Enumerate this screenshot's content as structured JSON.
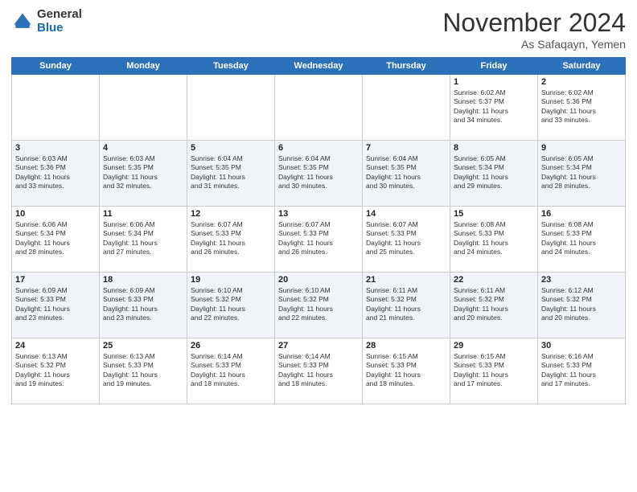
{
  "header": {
    "logo_general": "General",
    "logo_blue": "Blue",
    "month_title": "November 2024",
    "location": "As Safaqayn, Yemen"
  },
  "days_of_week": [
    "Sunday",
    "Monday",
    "Tuesday",
    "Wednesday",
    "Thursday",
    "Friday",
    "Saturday"
  ],
  "weeks": [
    [
      {
        "day": "",
        "info": ""
      },
      {
        "day": "",
        "info": ""
      },
      {
        "day": "",
        "info": ""
      },
      {
        "day": "",
        "info": ""
      },
      {
        "day": "",
        "info": ""
      },
      {
        "day": "1",
        "info": "Sunrise: 6:02 AM\nSunset: 5:37 PM\nDaylight: 11 hours\nand 34 minutes."
      },
      {
        "day": "2",
        "info": "Sunrise: 6:02 AM\nSunset: 5:36 PM\nDaylight: 11 hours\nand 33 minutes."
      }
    ],
    [
      {
        "day": "3",
        "info": "Sunrise: 6:03 AM\nSunset: 5:36 PM\nDaylight: 11 hours\nand 33 minutes."
      },
      {
        "day": "4",
        "info": "Sunrise: 6:03 AM\nSunset: 5:35 PM\nDaylight: 11 hours\nand 32 minutes."
      },
      {
        "day": "5",
        "info": "Sunrise: 6:04 AM\nSunset: 5:35 PM\nDaylight: 11 hours\nand 31 minutes."
      },
      {
        "day": "6",
        "info": "Sunrise: 6:04 AM\nSunset: 5:35 PM\nDaylight: 11 hours\nand 30 minutes."
      },
      {
        "day": "7",
        "info": "Sunrise: 6:04 AM\nSunset: 5:35 PM\nDaylight: 11 hours\nand 30 minutes."
      },
      {
        "day": "8",
        "info": "Sunrise: 6:05 AM\nSunset: 5:34 PM\nDaylight: 11 hours\nand 29 minutes."
      },
      {
        "day": "9",
        "info": "Sunrise: 6:05 AM\nSunset: 5:34 PM\nDaylight: 11 hours\nand 28 minutes."
      }
    ],
    [
      {
        "day": "10",
        "info": "Sunrise: 6:06 AM\nSunset: 5:34 PM\nDaylight: 11 hours\nand 28 minutes."
      },
      {
        "day": "11",
        "info": "Sunrise: 6:06 AM\nSunset: 5:34 PM\nDaylight: 11 hours\nand 27 minutes."
      },
      {
        "day": "12",
        "info": "Sunrise: 6:07 AM\nSunset: 5:33 PM\nDaylight: 11 hours\nand 26 minutes."
      },
      {
        "day": "13",
        "info": "Sunrise: 6:07 AM\nSunset: 5:33 PM\nDaylight: 11 hours\nand 26 minutes."
      },
      {
        "day": "14",
        "info": "Sunrise: 6:07 AM\nSunset: 5:33 PM\nDaylight: 11 hours\nand 25 minutes."
      },
      {
        "day": "15",
        "info": "Sunrise: 6:08 AM\nSunset: 5:33 PM\nDaylight: 11 hours\nand 24 minutes."
      },
      {
        "day": "16",
        "info": "Sunrise: 6:08 AM\nSunset: 5:33 PM\nDaylight: 11 hours\nand 24 minutes."
      }
    ],
    [
      {
        "day": "17",
        "info": "Sunrise: 6:09 AM\nSunset: 5:33 PM\nDaylight: 11 hours\nand 23 minutes."
      },
      {
        "day": "18",
        "info": "Sunrise: 6:09 AM\nSunset: 5:33 PM\nDaylight: 11 hours\nand 23 minutes."
      },
      {
        "day": "19",
        "info": "Sunrise: 6:10 AM\nSunset: 5:32 PM\nDaylight: 11 hours\nand 22 minutes."
      },
      {
        "day": "20",
        "info": "Sunrise: 6:10 AM\nSunset: 5:32 PM\nDaylight: 11 hours\nand 22 minutes."
      },
      {
        "day": "21",
        "info": "Sunrise: 6:11 AM\nSunset: 5:32 PM\nDaylight: 11 hours\nand 21 minutes."
      },
      {
        "day": "22",
        "info": "Sunrise: 6:11 AM\nSunset: 5:32 PM\nDaylight: 11 hours\nand 20 minutes."
      },
      {
        "day": "23",
        "info": "Sunrise: 6:12 AM\nSunset: 5:32 PM\nDaylight: 11 hours\nand 20 minutes."
      }
    ],
    [
      {
        "day": "24",
        "info": "Sunrise: 6:13 AM\nSunset: 5:32 PM\nDaylight: 11 hours\nand 19 minutes."
      },
      {
        "day": "25",
        "info": "Sunrise: 6:13 AM\nSunset: 5:33 PM\nDaylight: 11 hours\nand 19 minutes."
      },
      {
        "day": "26",
        "info": "Sunrise: 6:14 AM\nSunset: 5:33 PM\nDaylight: 11 hours\nand 18 minutes."
      },
      {
        "day": "27",
        "info": "Sunrise: 6:14 AM\nSunset: 5:33 PM\nDaylight: 11 hours\nand 18 minutes."
      },
      {
        "day": "28",
        "info": "Sunrise: 6:15 AM\nSunset: 5:33 PM\nDaylight: 11 hours\nand 18 minutes."
      },
      {
        "day": "29",
        "info": "Sunrise: 6:15 AM\nSunset: 5:33 PM\nDaylight: 11 hours\nand 17 minutes."
      },
      {
        "day": "30",
        "info": "Sunrise: 6:16 AM\nSunset: 5:33 PM\nDaylight: 11 hours\nand 17 minutes."
      }
    ]
  ]
}
